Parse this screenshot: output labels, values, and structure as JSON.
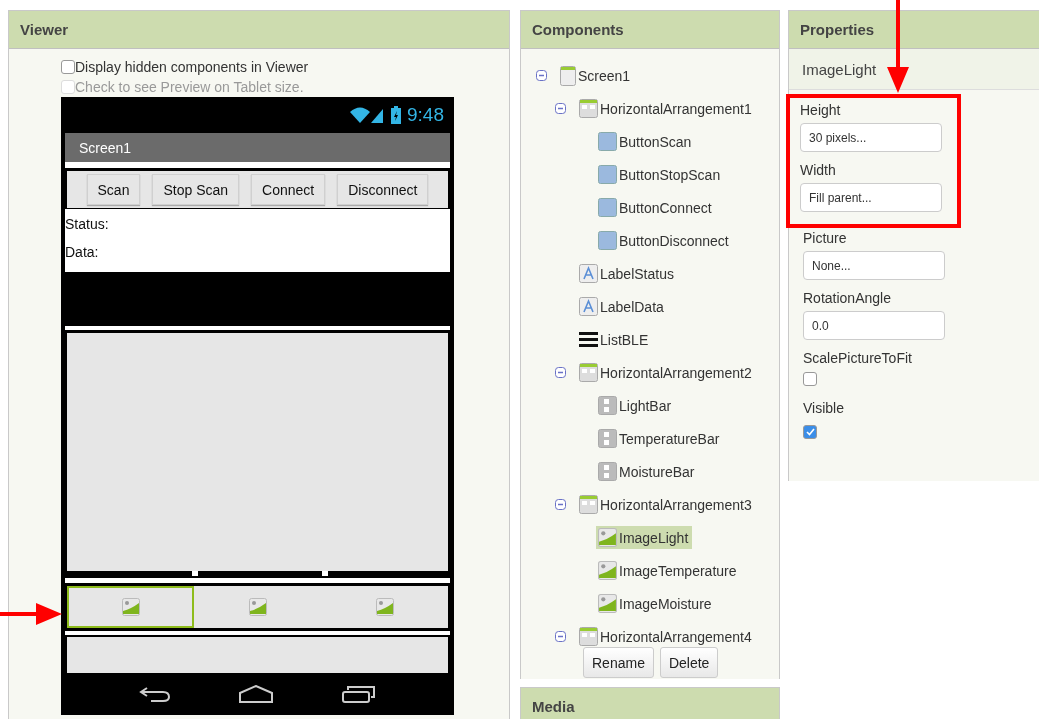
{
  "viewer": {
    "title": "Viewer",
    "options": [
      {
        "label": "Display hidden components in Viewer",
        "checked": false,
        "disabled": false
      },
      {
        "label": "Check to see Preview on Tablet size.",
        "checked": false,
        "disabled": true
      }
    ],
    "phone": {
      "time": "9:48",
      "screen_title": "Screen1",
      "buttons": [
        "Scan",
        "Stop Scan",
        "Connect",
        "Disconnect"
      ],
      "labels": [
        "Status:",
        "Data:"
      ],
      "images": [
        {
          "selected": true
        },
        {
          "selected": false
        },
        {
          "selected": false
        }
      ]
    }
  },
  "components": {
    "title": "Components",
    "tree": [
      {
        "name": "Screen1",
        "kind": "screen",
        "expanded": true,
        "selected": false,
        "children": [
          {
            "name": "HorizontalArrangement1",
            "kind": "arrangement",
            "expanded": true,
            "selected": false,
            "children": [
              {
                "name": "ButtonScan",
                "kind": "button",
                "selected": false
              },
              {
                "name": "ButtonStopScan",
                "kind": "button",
                "selected": false
              },
              {
                "name": "ButtonConnect",
                "kind": "button",
                "selected": false
              },
              {
                "name": "ButtonDisconnect",
                "kind": "button",
                "selected": false
              }
            ]
          },
          {
            "name": "LabelStatus",
            "kind": "label",
            "selected": false
          },
          {
            "name": "LabelData",
            "kind": "label",
            "selected": false
          },
          {
            "name": "ListBLE",
            "kind": "list",
            "selected": false
          },
          {
            "name": "HorizontalArrangement2",
            "kind": "arrangement",
            "expanded": true,
            "selected": false,
            "children": [
              {
                "name": "LightBar",
                "kind": "slider",
                "selected": false
              },
              {
                "name": "TemperatureBar",
                "kind": "slider",
                "selected": false
              },
              {
                "name": "MoistureBar",
                "kind": "slider",
                "selected": false
              }
            ]
          },
          {
            "name": "HorizontalArrangement3",
            "kind": "arrangement",
            "expanded": true,
            "selected": false,
            "children": [
              {
                "name": "ImageLight",
                "kind": "image",
                "selected": true
              },
              {
                "name": "ImageTemperature",
                "kind": "image",
                "selected": false
              },
              {
                "name": "ImageMoisture",
                "kind": "image",
                "selected": false
              }
            ]
          },
          {
            "name": "HorizontalArrangement4",
            "kind": "arrangement",
            "expanded": true,
            "selected": false
          }
        ]
      }
    ],
    "buttons": [
      "Rename",
      "Delete"
    ],
    "next_panel": "Media"
  },
  "properties": {
    "title": "Properties",
    "component": "ImageLight",
    "items": [
      {
        "label": "Height",
        "kind": "field",
        "value": "30 pixels...",
        "highlighted": true
      },
      {
        "label": "Width",
        "kind": "field",
        "value": "Fill parent...",
        "highlighted": true
      },
      {
        "label": "Picture",
        "kind": "field",
        "value": "None...",
        "highlighted": false
      },
      {
        "label": "RotationAngle",
        "kind": "field",
        "value": "0.0",
        "highlighted": false
      },
      {
        "label": "ScalePictureToFit",
        "kind": "checkbox",
        "checked": false,
        "highlighted": false
      },
      {
        "label": "Visible",
        "kind": "checkbox",
        "checked": true,
        "highlighted": false
      }
    ]
  }
}
